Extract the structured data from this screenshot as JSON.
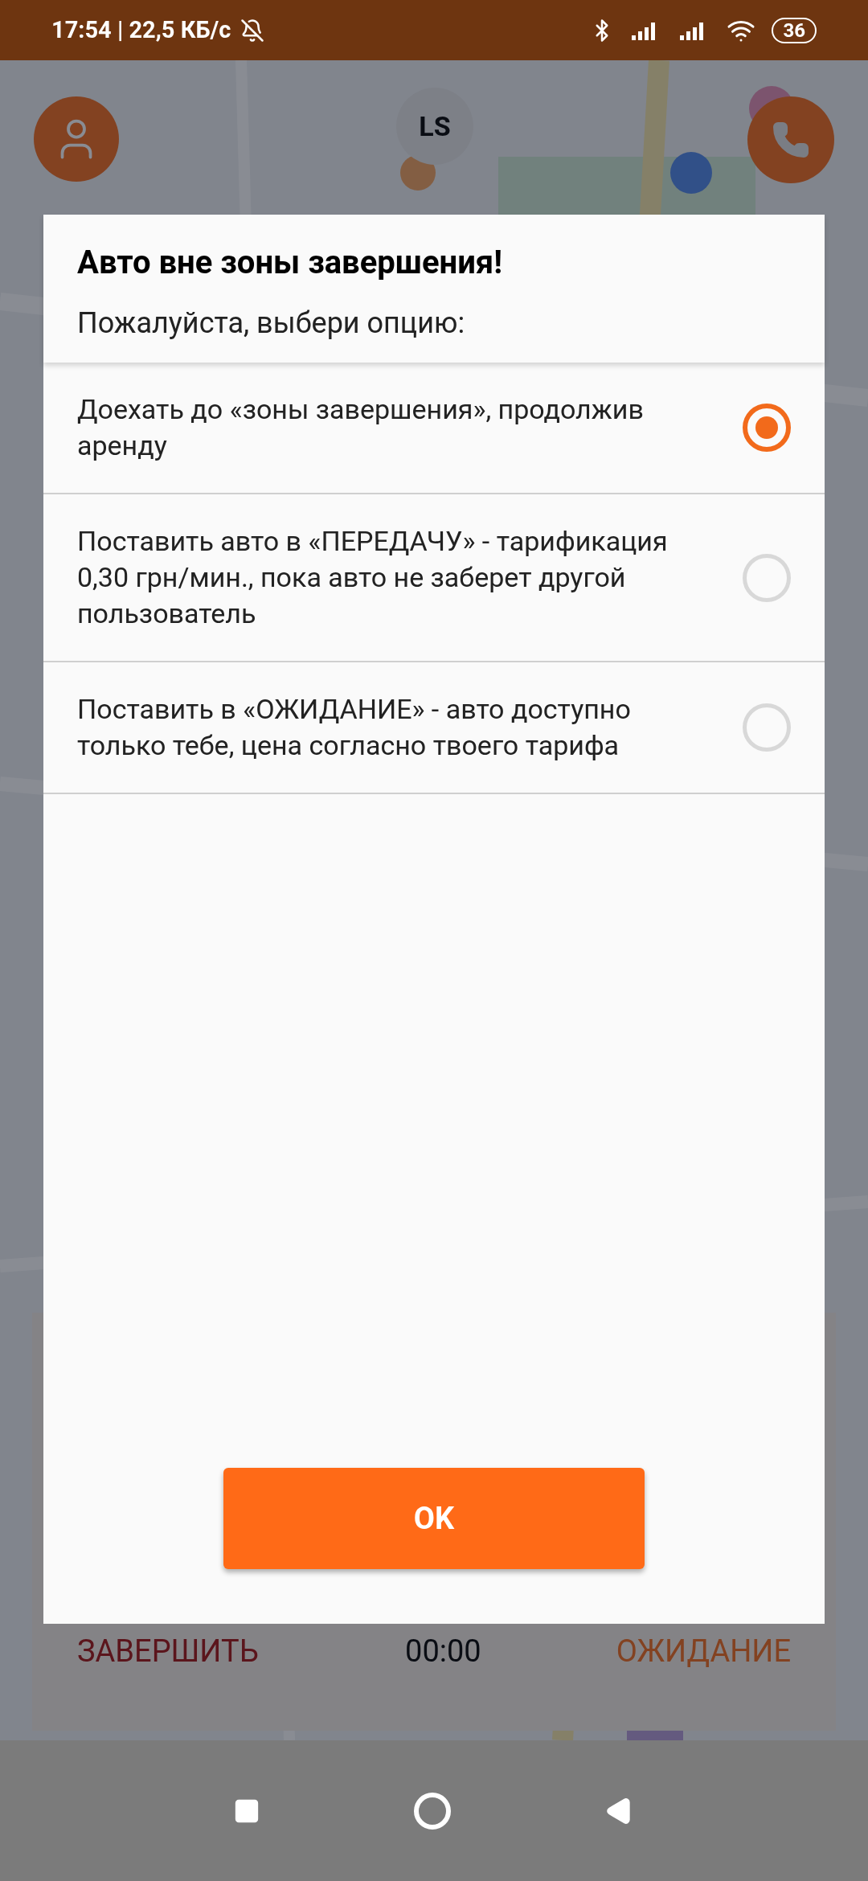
{
  "status_bar": {
    "time": "17:54 | 22,5 КБ/с",
    "battery": "36"
  },
  "map_overlay": {
    "avatar_initials": "LS"
  },
  "bottom_panel": {
    "finish_label": "ЗАВЕРШИТЬ",
    "timer": "00:00",
    "wait_label": "ОЖИДАНИЕ"
  },
  "dialog": {
    "title": "Авто вне зоны завершения!",
    "subtitle": "Пожалуйста, выбери опцию:",
    "options": [
      {
        "label": "Доехать до «зоны завершения», продолжив аренду",
        "selected": true
      },
      {
        "label": "Поставить авто в «ПЕРЕДАЧУ» - тарификация 0,30 грн/мин., пока авто не заберет другой пользователь",
        "selected": false
      },
      {
        "label": "Поставить в «ОЖИДАНИЕ» - авто доступно только тебе, цена согласно твоего тарифа",
        "selected": false
      }
    ],
    "ok_button": "OK"
  }
}
